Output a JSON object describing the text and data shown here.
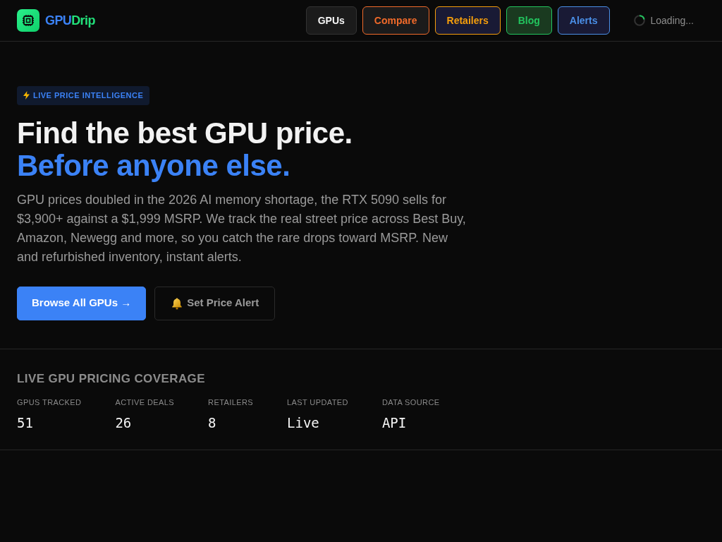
{
  "header": {
    "brand": [
      {
        "text": "GPU",
        "color": "#3b82f6"
      },
      {
        "text": "Drip",
        "color": "#22e07a"
      }
    ],
    "nav": [
      {
        "label": "GPUs"
      },
      {
        "label": "Compare",
        "color": "#f06a2a"
      },
      {
        "label": "Retailers",
        "color": "#f59e0b"
      },
      {
        "label": "Blog",
        "color": "#22c55e"
      },
      {
        "label": "Alerts",
        "color": "#4a8fe7"
      }
    ],
    "status": "Loading..."
  },
  "hero": {
    "badge": "LIVE PRICE INTELLIGENCE",
    "title": "Find the best GPU price.",
    "title_accent": "Before anyone else.",
    "description": "GPU prices doubled in the 2026 AI memory shortage, the RTX 5090 sells for $3,900+ against a $1,999 MSRP. We track the real street price across Best Buy, Amazon, Newegg and more, so you catch the rare drops toward MSRP. New and refurbished inventory, instant alerts.",
    "buttons": [
      {
        "label": "Browse All GPUs →",
        "kind": "primary"
      },
      {
        "label": "Set Price Alert",
        "kind": "alert"
      }
    ]
  },
  "coverage": {
    "title": "LIVE GPU PRICING COVERAGE",
    "stats": [
      {
        "label": "GPUS TRACKED",
        "value": "51"
      },
      {
        "label": "ACTIVE DEALS",
        "value": "26"
      },
      {
        "label": "RETAILERS",
        "value": "8"
      },
      {
        "label": "LAST UPDATED",
        "value": "Live"
      },
      {
        "label": "DATA SOURCE",
        "value": "API"
      }
    ]
  }
}
